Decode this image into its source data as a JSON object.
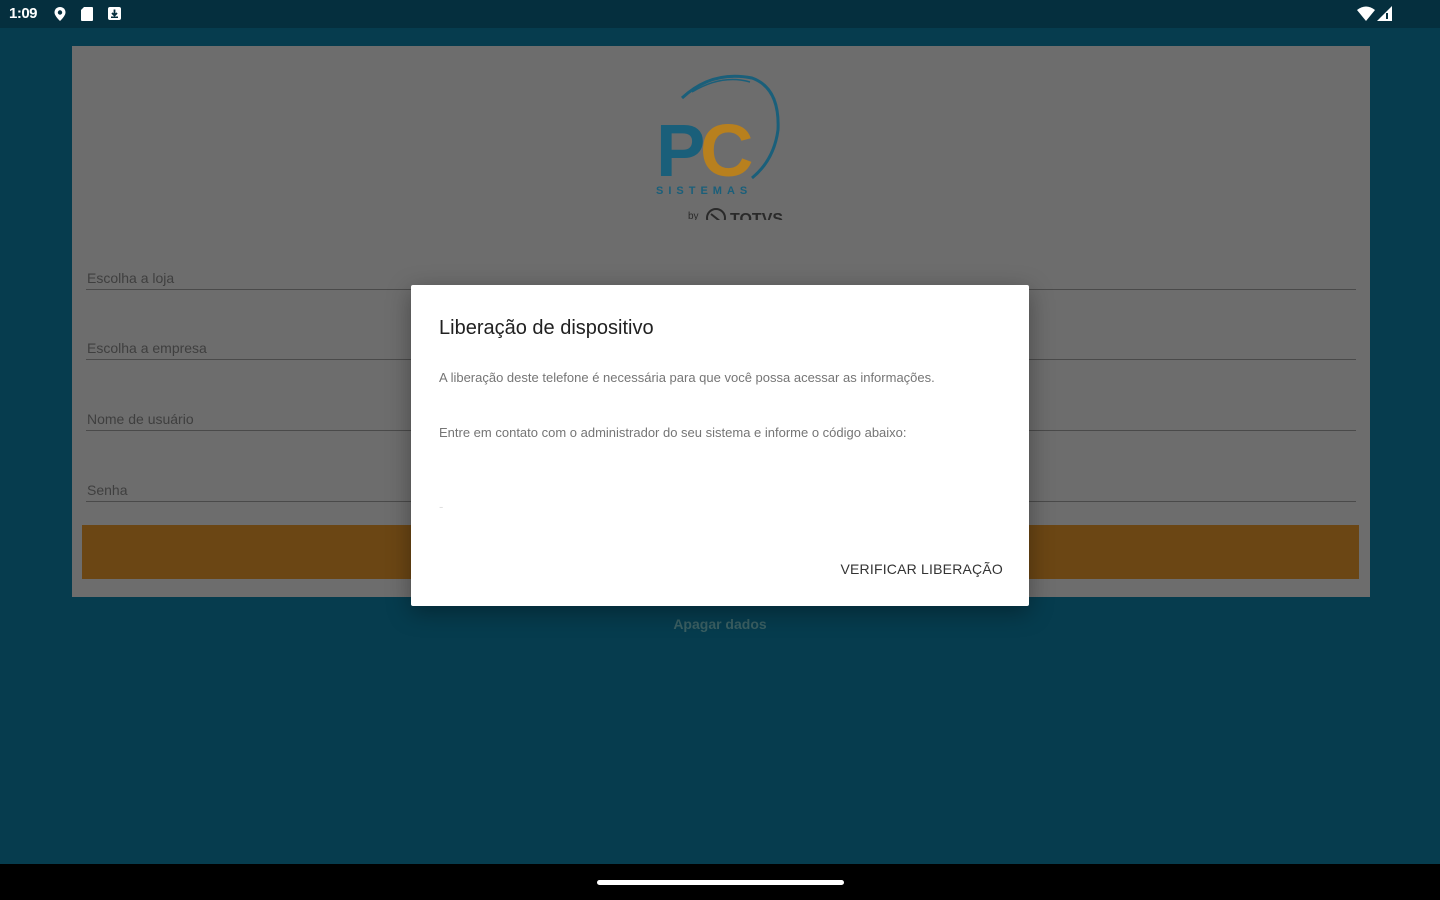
{
  "status_bar": {
    "time": "1:09",
    "left_icons": [
      "location-pin-icon",
      "sd-card-icon",
      "download-icon"
    ],
    "right_icons": [
      "wifi-icon",
      "cellular-signal-icon"
    ]
  },
  "logo": {
    "letters": "PC",
    "sub": "SISTEMAS",
    "by": "by",
    "brand": "TOTVS",
    "colors": {
      "p": "#1a5f7a",
      "c": "#b8801e"
    }
  },
  "form": {
    "fields": [
      {
        "label": "Escolha a loja"
      },
      {
        "label": "Escolha a empresa"
      },
      {
        "label": "Nome de usuário"
      },
      {
        "label": "Senha"
      }
    ],
    "clear_data_label": "Apagar dados"
  },
  "dialog": {
    "title": "Liberação de dispositivo",
    "paragraph_1": "A liberação deste telefone é necessária para que você possa acessar as informações.",
    "paragraph_2": "Entre em contato com o administrador do seu sistema e informe o código abaixo:",
    "code": "-",
    "action_label": "VERIFICAR LIBERAÇÃO"
  },
  "colors": {
    "background": "#063c4e",
    "status_bar": "#052f3e",
    "accent_button": "#6b4614",
    "card": "#6d6d6d"
  }
}
